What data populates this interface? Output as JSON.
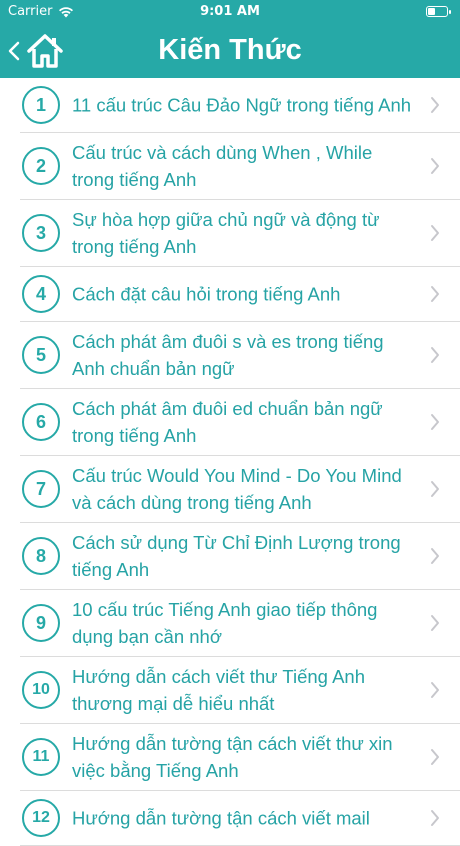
{
  "status_bar": {
    "carrier": "Carrier",
    "time": "9:01 AM",
    "battery_level": 0.4
  },
  "nav": {
    "title": "Kiến Thức",
    "back_icon": "chevron-left-icon",
    "home_icon": "home-icon"
  },
  "colors": {
    "accent": "#26a9a7",
    "text": "#26a3a5",
    "chevron": "#c7c7cc",
    "divider": "#dcdcdc"
  },
  "items": [
    {
      "num": "1",
      "title": "11 cấu trúc Câu Đảo Ngữ trong tiếng Anh"
    },
    {
      "num": "2",
      "title": "Cấu trúc và cách dùng When , While trong tiếng Anh"
    },
    {
      "num": "3",
      "title": "Sự hòa hợp giữa chủ ngữ và động từ trong tiếng Anh"
    },
    {
      "num": "4",
      "title": "Cách đặt câu hỏi trong tiếng Anh"
    },
    {
      "num": "5",
      "title": "Cách phát âm đuôi s và es trong tiếng Anh chuẩn bản ngữ"
    },
    {
      "num": "6",
      "title": "Cách phát âm đuôi ed chuẩn bản ngữ trong tiếng Anh"
    },
    {
      "num": "7",
      "title": "Cấu trúc Would You Mind - Do You Mind và cách dùng trong tiếng Anh"
    },
    {
      "num": "8",
      "title": "Cách sử dụng Từ Chỉ Định Lượng trong tiếng Anh"
    },
    {
      "num": "9",
      "title": "10 cấu trúc Tiếng Anh giao tiếp thông dụng bạn cần nhớ"
    },
    {
      "num": "10",
      "title": "Hướng dẫn cách viết thư Tiếng Anh thương mại dễ hiểu nhất"
    },
    {
      "num": "11",
      "title": "Hướng dẫn tường tận cách viết thư xin việc bằng Tiếng Anh"
    },
    {
      "num": "12",
      "title": "Hướng dẫn tường tận cách viết mail"
    }
  ]
}
